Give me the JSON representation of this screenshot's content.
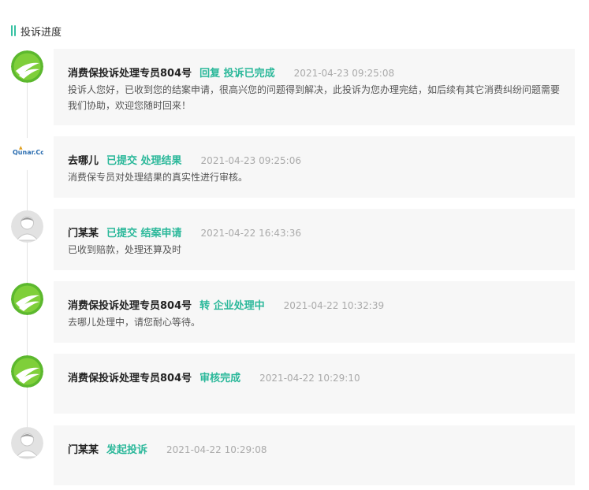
{
  "header": {
    "title": "投诉进度"
  },
  "entries": [
    {
      "name": "消费保投诉处理专员804号",
      "status": "回复 投诉已完成",
      "time": "2021-04-23 09:25:08",
      "content": "投诉人您好，已收到您的结案申请，很高兴您的问题得到解决，此投诉为您办理完结，如后续有其它消费纠纷问题需要我们协助，欢迎您随时回来！",
      "avatar": "xiaofeibao-logo-icon"
    },
    {
      "name": "去哪儿",
      "status": "已提交 处理结果",
      "time": "2021-04-23 09:25:06",
      "content": "消费保专员对处理结果的真实性进行审核。",
      "avatar": "qunar-logo-icon",
      "logo_text": "Qunar.Com"
    },
    {
      "name": "门某某",
      "status": "已提交 结案申请",
      "time": "2021-04-22 16:43:36",
      "content": "已收到赔款，处理还算及时",
      "avatar": "user-avatar-icon"
    },
    {
      "name": "消费保投诉处理专员804号",
      "status": "转 企业处理中",
      "time": "2021-04-22 10:32:39",
      "content": "去哪儿处理中，请您耐心等待。",
      "avatar": "xiaofeibao-logo-icon"
    },
    {
      "name": "消费保投诉处理专员804号",
      "status": "审核完成",
      "time": "2021-04-22 10:29:10",
      "content": "",
      "avatar": "xiaofeibao-logo-icon"
    },
    {
      "name": "门某某",
      "status": "发起投诉",
      "time": "2021-04-22 10:29:08",
      "content": "",
      "avatar": "user-avatar-icon"
    }
  ],
  "colors": {
    "accent": "#2bb89a",
    "card_bg": "#f7f7f7",
    "time": "#aaaaaa"
  }
}
